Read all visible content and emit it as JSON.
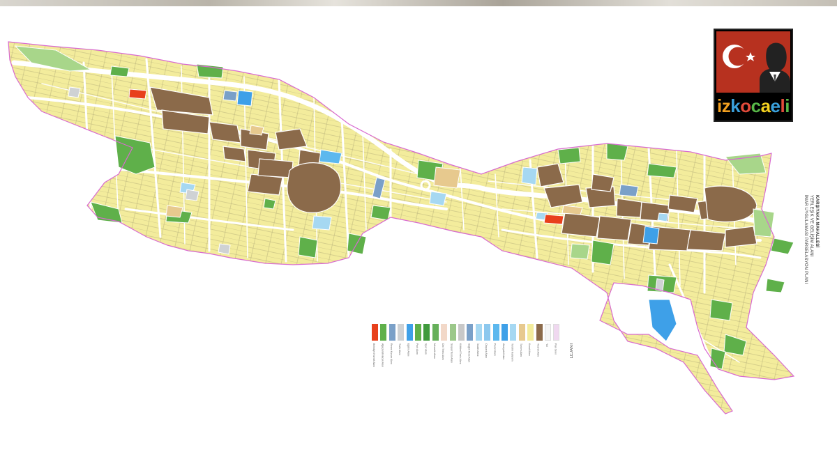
{
  "logo": {
    "brand_parts": [
      {
        "text": "iz",
        "color": "#f2a020"
      },
      {
        "text": "k",
        "color": "#3aa0dc"
      },
      {
        "text": "o",
        "color": "#e04a3a"
      },
      {
        "text": "c",
        "color": "#58b848"
      },
      {
        "text": "a",
        "color": "#f2d020"
      },
      {
        "text": "e",
        "color": "#3aa0dc"
      },
      {
        "text": "l",
        "color": "#e04a3a"
      },
      {
        "text": "i",
        "color": "#58b848"
      }
    ],
    "flag_color": "#b7311f"
  },
  "plan_title": {
    "line1": "KARŞIYAKA MAHALLESİ",
    "line2": "YERLEŞİK VE GELİŞİM ALANI",
    "line3": "İMAR UYGULAMASI PARSELASYON PLANI"
  },
  "legend": {
    "title": "LEJANT",
    "colors": {
      "residential": "#f3ec9c",
      "commercial": "#8b6a4a",
      "green": "#5fb04a",
      "light_green": "#a8d68a",
      "blue": "#3ea0e8",
      "light_blue": "#a6d8f2",
      "red": "#e8401c",
      "gray": "#cfd2d4",
      "tan": "#e7c98e",
      "road": "#ffffff",
      "boundary": "#d86ad0"
    },
    "items": [
      {
        "label": "Belediye Hizmet Alanı",
        "color": "#e8401c"
      },
      {
        "label": "Ağaçlandırılacak Alan",
        "color": "#5fb04a"
      },
      {
        "label": "Resmi Kurum Alanı",
        "color": "#7aa0c8"
      },
      {
        "label": "Trafo Alanı",
        "color": "#cfd2d4"
      },
      {
        "label": "Eğitim Alanı",
        "color": "#3ea0e8"
      },
      {
        "label": "Park Alanı",
        "color": "#5fb04a"
      },
      {
        "label": "Spor Alanı",
        "color": "#3f9a3c"
      },
      {
        "label": "Mezarlık Alanı",
        "color": "#66b05a"
      },
      {
        "label": "Dini Tesis Alanı",
        "color": "#f2d8c8"
      },
      {
        "label": "Sosyal Tesis Alanı",
        "color": "#9cc88a"
      },
      {
        "label": "Kültürel Tesis Alanı",
        "color": "#c8c8c8"
      },
      {
        "label": "Sağlık Tesis Alanı",
        "color": "#7aa0c8"
      },
      {
        "label": "İbadet Alanı",
        "color": "#a6d8f2"
      },
      {
        "label": "Otopark Alanı",
        "color": "#8cc8ee"
      },
      {
        "label": "Pazar Alanı",
        "color": "#5cb8ee"
      },
      {
        "label": "Akaryakıt Alanı",
        "color": "#3ea0e8"
      },
      {
        "label": "Tercihli Kullanım",
        "color": "#a6d8f2"
      },
      {
        "label": "Turizm Alanı",
        "color": "#e7c98e"
      },
      {
        "label": "Konut Alanı",
        "color": "#f3ec9c"
      },
      {
        "label": "Ticaret Alanı",
        "color": "#8b6a4a"
      },
      {
        "label": "Yol",
        "color": "#f4f4f4"
      },
      {
        "label": "Plan Sınırı",
        "color": "#f0d8f0"
      }
    ]
  }
}
